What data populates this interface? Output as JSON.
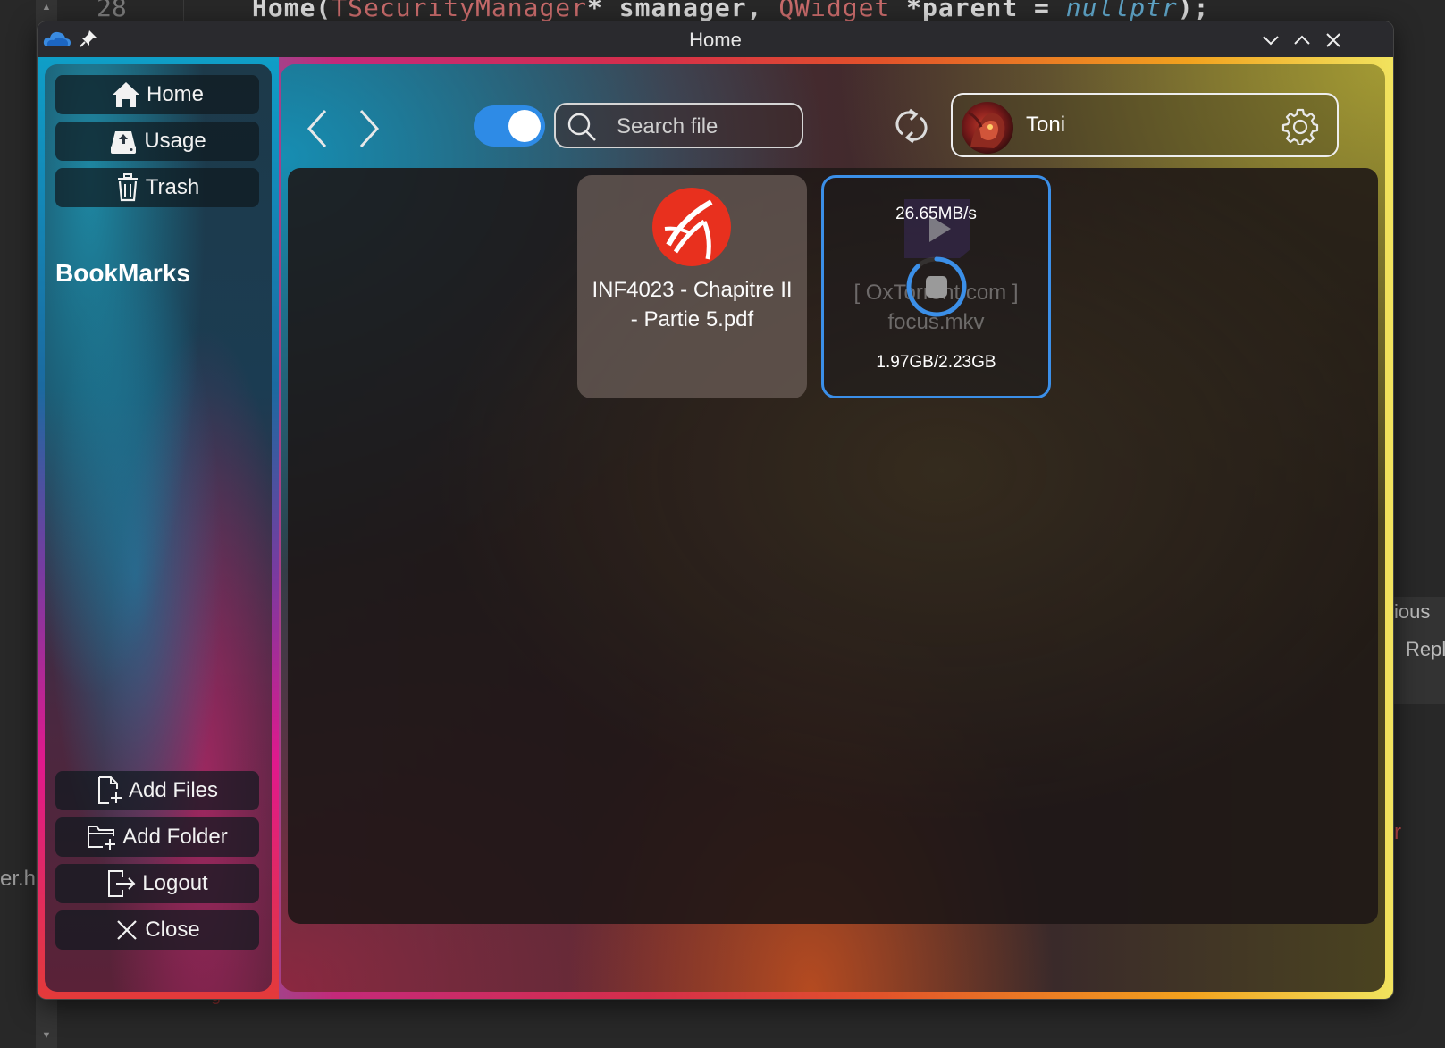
{
  "background": {
    "line_number": "28",
    "code_parts": [
      "Home(",
      "TSecurityManager",
      "* smanager,",
      "QWidget",
      " *parent = ",
      "nullptr",
      ");"
    ],
    "left_text": "er.h",
    "right_text_1": "ious",
    "right_text_2": "Repl",
    "right_text_3": "r",
    "bottom_text": "g"
  },
  "window": {
    "title": "Home"
  },
  "sidebar": {
    "items": [
      {
        "label": "Home",
        "icon": "home-icon"
      },
      {
        "label": "Usage",
        "icon": "upload-drive-icon"
      },
      {
        "label": "Trash",
        "icon": "trash-icon"
      }
    ],
    "bookmarks_title": "BookMarks",
    "bottom_items": [
      {
        "label": "Add Files",
        "icon": "add-file-icon"
      },
      {
        "label": "Add Folder",
        "icon": "add-folder-icon"
      },
      {
        "label": "Logout",
        "icon": "logout-icon"
      },
      {
        "label": "Close",
        "icon": "close-icon"
      }
    ]
  },
  "toolbar": {
    "search_placeholder": "Search file",
    "toggle_on": true,
    "accent_color": "#2e8be6"
  },
  "user": {
    "name": "Toni"
  },
  "files": [
    {
      "name": "INF4023 - Chapitre II - Partie 5.pdf",
      "type": "pdf-icon"
    },
    {
      "name": "[ OxTorrent.com ] focus.mkv",
      "type": "video-icon",
      "speed": "26.65MB/s",
      "progress": "1.97GB/2.23GB",
      "progress_fraction": 0.883
    }
  ]
}
